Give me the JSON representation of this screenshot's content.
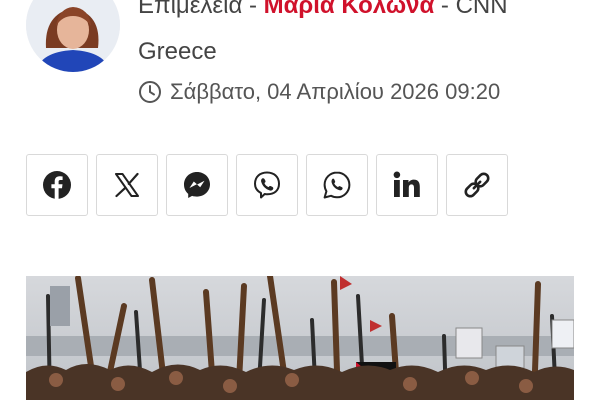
{
  "byline": {
    "prefix": "Επιμέλεια - ",
    "author": "Μαρία Κολώνα",
    "suffix": " - CNN",
    "line2": "Greece"
  },
  "date": {
    "icon": "clock-icon",
    "text": "Σάββατο, 04 Απριλίου 2026 09:20"
  },
  "share": {
    "buttons": [
      {
        "name": "facebook",
        "icon": "facebook-icon"
      },
      {
        "name": "x",
        "icon": "x-icon"
      },
      {
        "name": "messenger",
        "icon": "messenger-icon"
      },
      {
        "name": "viber",
        "icon": "viber-icon"
      },
      {
        "name": "whatsapp",
        "icon": "whatsapp-icon"
      },
      {
        "name": "linkedin",
        "icon": "linkedin-icon"
      },
      {
        "name": "copy-link",
        "icon": "link-icon"
      }
    ]
  },
  "colors": {
    "author_red": "#d0112b",
    "icon_dark": "#222222",
    "border": "#d9d9d9"
  }
}
